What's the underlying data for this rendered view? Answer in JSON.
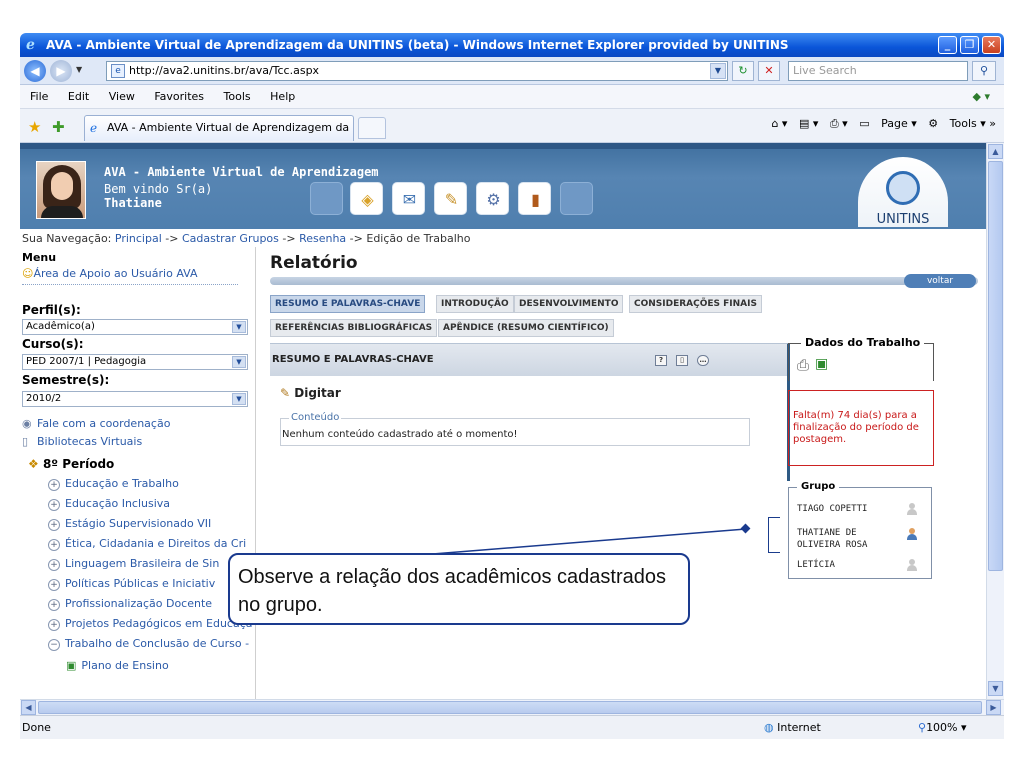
{
  "browser": {
    "title": "AVA - Ambiente Virtual de Aprendizagem da UNITINS (beta) - Windows Internet Explorer provided by UNITINS",
    "url": "http://ava2.unitins.br/ava/Tcc.aspx",
    "search_placeholder": "Live Search",
    "menu": [
      "File",
      "Edit",
      "View",
      "Favorites",
      "Tools",
      "Help"
    ],
    "tab_title": "AVA - Ambiente Virtual de Aprendizagem da UNITINS ...",
    "cmd_page": "Page",
    "cmd_tools": "Tools",
    "status": "Done",
    "zone": "Internet",
    "zoom": "100%"
  },
  "header": {
    "site_title": "AVA - Ambiente Virtual de Aprendizagem",
    "welcome": "Bem vindo Sr(a)",
    "user": "Thatiane",
    "logo_text": "UNITINS"
  },
  "breadcrumb": {
    "prefix": "Sua Navegação:",
    "items": [
      "Principal",
      "Cadastrar Grupos",
      "Resenha",
      "Edição de Trabalho"
    ]
  },
  "sidebar": {
    "menu_label": "Menu",
    "support_link": "Área de Apoio ao Usuário AVA",
    "perfil_label": "Perfil(s):",
    "perfil_value": "Acadêmico(a)",
    "curso_label": "Curso(s):",
    "curso_value": "PED 2007/1 | Pedagogia",
    "semestre_label": "Semestre(s):",
    "semestre_value": "2010/2",
    "fale": "Fale com a coordenação",
    "bibliotecas": "Bibliotecas Virtuais",
    "period": "8º Período",
    "subjects": [
      "Educação e Trabalho",
      "Educação Inclusiva",
      "Estágio Supervisionado VII",
      "Ética, Cidadania e Direitos da Cri",
      "Linguagem Brasileira de Sin",
      "Políticas Públicas e Iniciativ",
      "Profissionalização Docente",
      "Projetos Pedagógicos em Educaçã",
      "Trabalho de Conclusão de Curso -"
    ],
    "plano": "Plano de Ensino"
  },
  "main": {
    "title": "Relatório",
    "voltar": "voltar",
    "tabs_row1": [
      "RESUMO E PALAVRAS-CHAVE",
      "INTRODUÇÃO",
      "DESENVOLVIMENTO",
      "CONSIDERAÇÕES FINAIS"
    ],
    "tabs_row2": [
      "REFERÊNCIAS BIBLIOGRÁFICAS",
      "APÊNDICE (RESUMO CIENTÍFICO)"
    ],
    "panel_title": "RESUMO E PALAVRAS-CHAVE",
    "digitar": "Digitar",
    "content_legend": "Conteúdo",
    "content_text": "Nenhum conteúdo cadastrado até o momento!"
  },
  "dados": {
    "label": "Dados do Trabalho",
    "falta": "Falta(m) 74 dia(s) para a finalização do período de postagem."
  },
  "grupo": {
    "label": "Grupo",
    "members": [
      "TIAGO COPETTI",
      "THATIANE DE OLIVEIRA ROSA",
      "LETÍCIA"
    ]
  },
  "callout": {
    "text": "Observe a relação dos acadêmicos cadastrados no grupo."
  }
}
